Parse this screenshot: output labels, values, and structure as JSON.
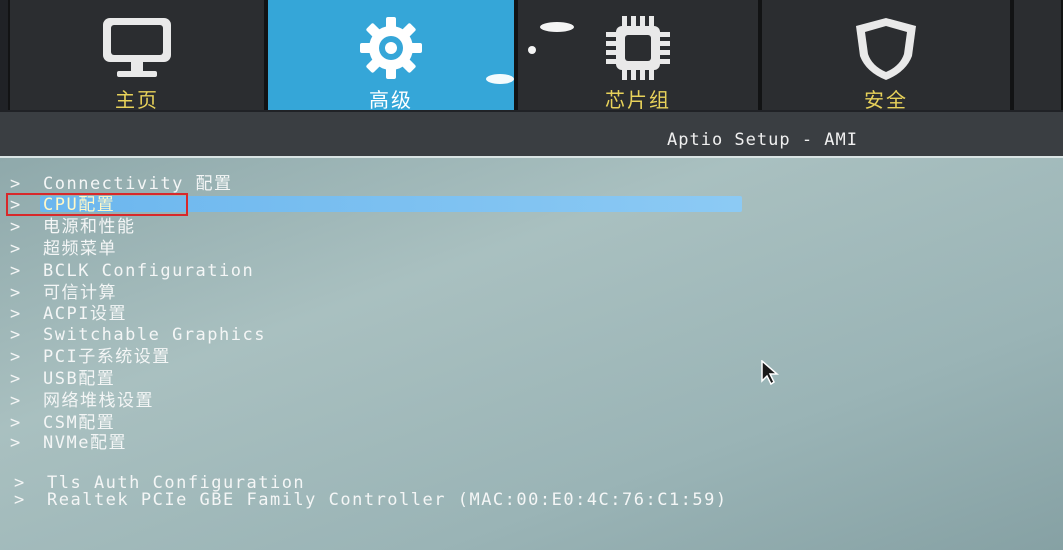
{
  "tabs": [
    {
      "label": "主页",
      "icon": "monitor-icon",
      "active": false
    },
    {
      "label": "高级",
      "icon": "gear-icon",
      "active": true
    },
    {
      "label": "芯片组",
      "icon": "chip-icon",
      "active": false
    },
    {
      "label": "安全",
      "icon": "shield-icon",
      "active": false
    }
  ],
  "header": {
    "title": "Aptio Setup - AMI"
  },
  "menu": {
    "arrow": ">",
    "items": [
      {
        "label": "Connectivity 配置"
      },
      {
        "label": "CPU配置",
        "selected": true
      },
      {
        "label": "电源和性能"
      },
      {
        "label": "超频菜单"
      },
      {
        "label": "BCLK Configuration"
      },
      {
        "label": "可信计算"
      },
      {
        "label": "ACPI设置"
      },
      {
        "label": "Switchable Graphics"
      },
      {
        "label": "PCI子系统设置"
      },
      {
        "label": "USB配置"
      },
      {
        "label": "网络堆栈设置"
      },
      {
        "label": "CSM配置"
      },
      {
        "label": "NVMe配置"
      },
      {
        "label": "Tls Auth Configuration"
      },
      {
        "label": "Realtek PCIe GBE Family Controller (MAC:00:E0:4C:76:C1:59)"
      }
    ]
  },
  "colors": {
    "active_tab": "#35a6d8",
    "tab_label": "#e8d25a",
    "selection": "#6bb6ee",
    "annotation": "#d8282a"
  }
}
